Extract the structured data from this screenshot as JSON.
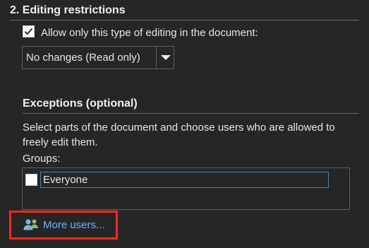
{
  "editing_restrictions": {
    "title": "2. Editing restrictions",
    "allow_checkbox": {
      "checked": true,
      "label": "Allow only this type of editing in the document:"
    },
    "editing_type_select": {
      "selected": "No changes (Read only)"
    }
  },
  "exceptions": {
    "title": "Exceptions (optional)",
    "description": "Select parts of the document and choose users who are allowed to freely edit them.",
    "groups_label": "Groups:",
    "groups": [
      {
        "label": "Everyone",
        "checked": false
      }
    ],
    "more_users_label": "More users..."
  },
  "colors": {
    "background": "#262626",
    "text": "#e6e6e6",
    "link": "#6ab0ff",
    "highlight_border": "#ff2a1a",
    "focus_border": "#4a7fc4"
  },
  "icons": {
    "checkbox_check": "checkmark-icon",
    "dropdown": "chevron-down-icon",
    "more_users": "users-icon"
  }
}
